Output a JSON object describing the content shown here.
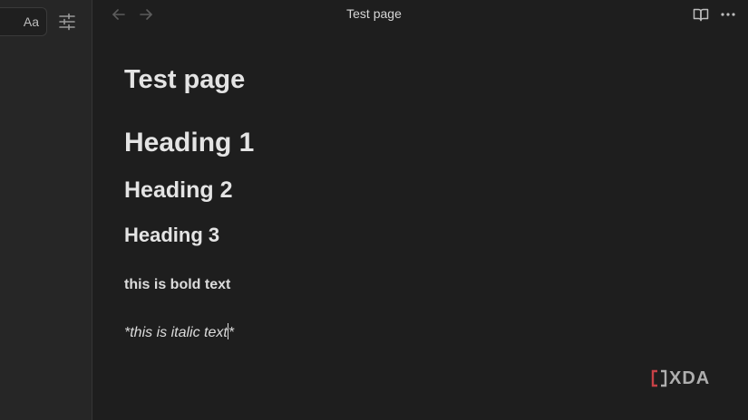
{
  "sidebar": {
    "font_button_label": "Aa",
    "settings_icon": "sliders-icon"
  },
  "topbar": {
    "back_icon": "arrow-left-icon",
    "forward_icon": "arrow-right-icon",
    "title": "Test page",
    "reading_icon": "book-open-icon",
    "more_icon": "more-horizontal-icon"
  },
  "editor": {
    "page_title": "Test page",
    "heading1": "Heading 1",
    "heading2": "Heading 2",
    "heading3": "Heading 3",
    "bold_text": "this is bold text",
    "italic_text_before_caret": "*this is italic text",
    "italic_text_after_caret": "*"
  },
  "watermark": {
    "text": "XDA",
    "accent_color": "#e5484d"
  },
  "colors": {
    "background": "#1e1e1e",
    "sidebar": "#262626",
    "text": "#dadada"
  }
}
